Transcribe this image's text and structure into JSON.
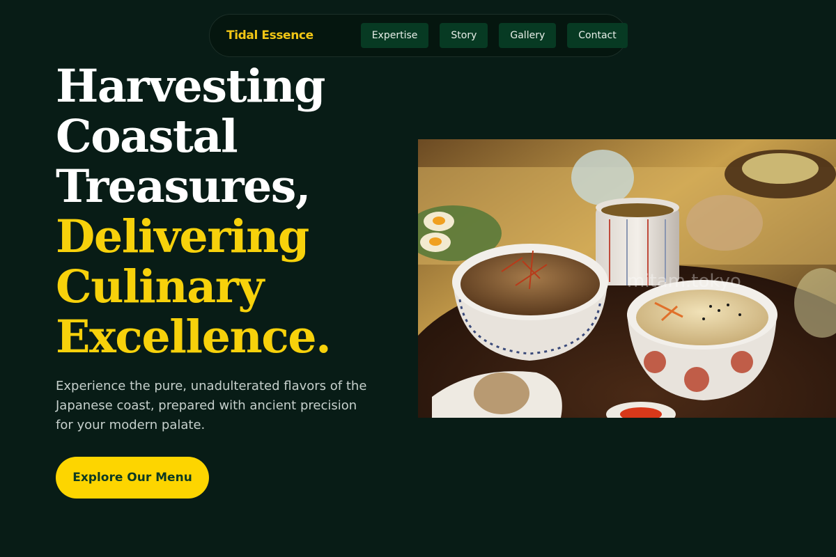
{
  "nav": {
    "brand": "Tidal Essence",
    "links": [
      "Expertise",
      "Story",
      "Gallery",
      "Contact"
    ]
  },
  "hero": {
    "headline_white": [
      "Harvesting",
      "Coastal",
      "Treasures,"
    ],
    "headline_yellow": [
      "Delivering",
      "Culinary",
      "Excellence."
    ],
    "description": "Experience the pure, unadulterated flavors of the Japanese coast, prepared with ancient precision for your modern palate.",
    "cta_label": "Explore Our Menu"
  },
  "image": {
    "watermark": "mitam.tokyo"
  },
  "colors": {
    "background": "#081c16",
    "accent": "#f7d10b",
    "nav_button": "#073a23",
    "cta_text": "#0d3a22"
  }
}
